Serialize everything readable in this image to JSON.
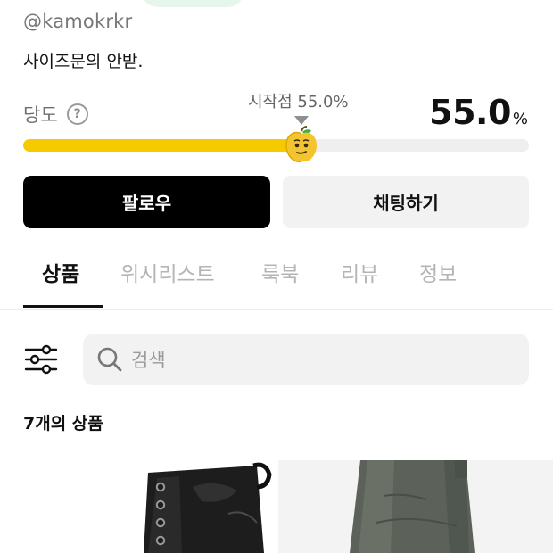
{
  "profile": {
    "handle": "@kamokrkr",
    "bio": "사이즈문의 안받."
  },
  "sweetness": {
    "label": "당도",
    "help_icon": "question-circle-icon",
    "start_label": "시작점 55.0%",
    "value_number": "55.0",
    "value_unit": "%",
    "level_percent": 55.0,
    "fill_color": "#f5cb00",
    "marker_icon": "apple-emoji-icon"
  },
  "actions": {
    "follow_label": "팔로우",
    "chat_label": "채팅하기"
  },
  "tabs": [
    {
      "label": "상품",
      "active": true
    },
    {
      "label": "위시리스트",
      "active": false
    },
    {
      "label": "룩북",
      "active": false
    },
    {
      "label": "리뷰",
      "active": false
    },
    {
      "label": "정보",
      "active": false
    }
  ],
  "search": {
    "placeholder": "검색",
    "filter_icon": "sliders-icon",
    "search_icon": "search-icon"
  },
  "products": {
    "count_label": "7개의 상품",
    "items": [
      {
        "image": "black-leather-boot"
      },
      {
        "image": "grey-cargo-pants"
      }
    ]
  },
  "colors": {
    "primary": "#000000",
    "accent": "#f5cb00",
    "muted_text": "#9a9a9a"
  }
}
